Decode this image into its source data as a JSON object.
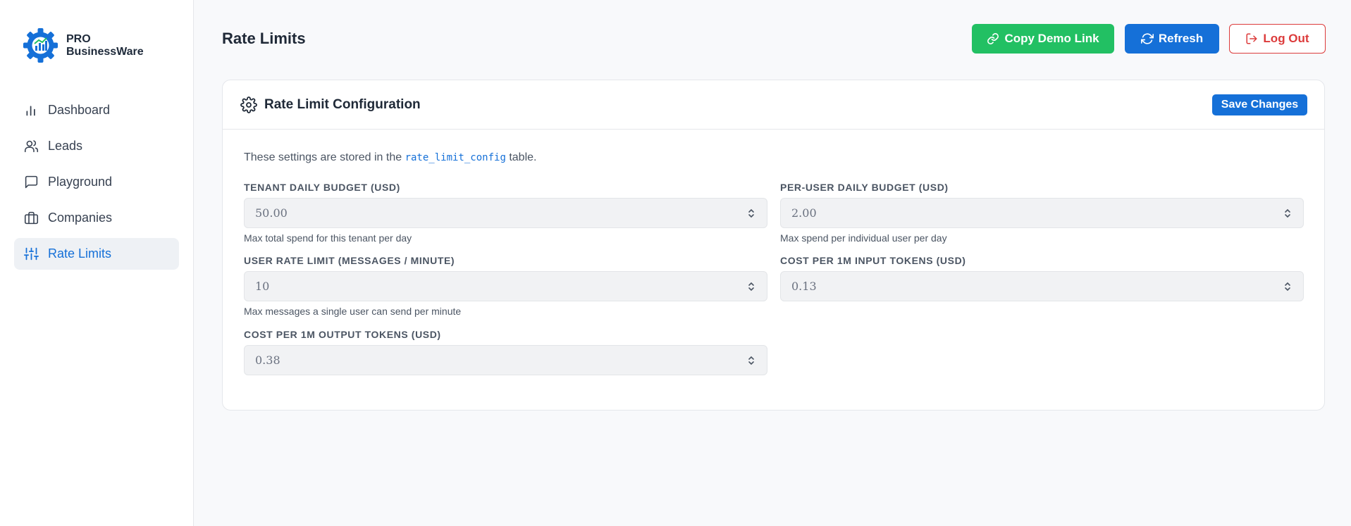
{
  "brand": {
    "line1": "PRO",
    "line2": "BusinessWare"
  },
  "nav": [
    {
      "label": "Dashboard",
      "icon": "bar-chart-icon"
    },
    {
      "label": "Leads",
      "icon": "users-icon"
    },
    {
      "label": "Playground",
      "icon": "message-square-icon"
    },
    {
      "label": "Companies",
      "icon": "briefcase-icon"
    },
    {
      "label": "Rate Limits",
      "icon": "sliders-icon"
    }
  ],
  "header": {
    "title": "Rate Limits",
    "copy_label": "Copy Demo Link",
    "refresh_label": "Refresh",
    "logout_label": "Log Out"
  },
  "card": {
    "title": "Rate Limit Configuration",
    "save_label": "Save Changes",
    "intro_prefix": "These settings are stored in the",
    "intro_code": "rate_limit_config",
    "intro_suffix": "table."
  },
  "fields": {
    "tenant_budget": {
      "label": "Tenant Daily Budget (USD)",
      "value": "50.00",
      "help": "Max total spend for this tenant per day"
    },
    "user_budget": {
      "label": "Per-User Daily Budget (USD)",
      "value": "2.00",
      "help": "Max spend per individual user per day"
    },
    "rate_limit": {
      "label": "User Rate Limit (Messages / Minute)",
      "value": "10",
      "help": "Max messages a single user can send per minute"
    },
    "input_cost": {
      "label": "Cost per 1M Input Tokens (USD)",
      "value": "0.13",
      "help": ""
    },
    "output_cost": {
      "label": "Cost per 1M Output Tokens (USD)",
      "value": "0.38",
      "help": ""
    }
  },
  "colors": {
    "primary": "#1570d8",
    "success": "#22c063",
    "danger": "#dc3b3b"
  }
}
